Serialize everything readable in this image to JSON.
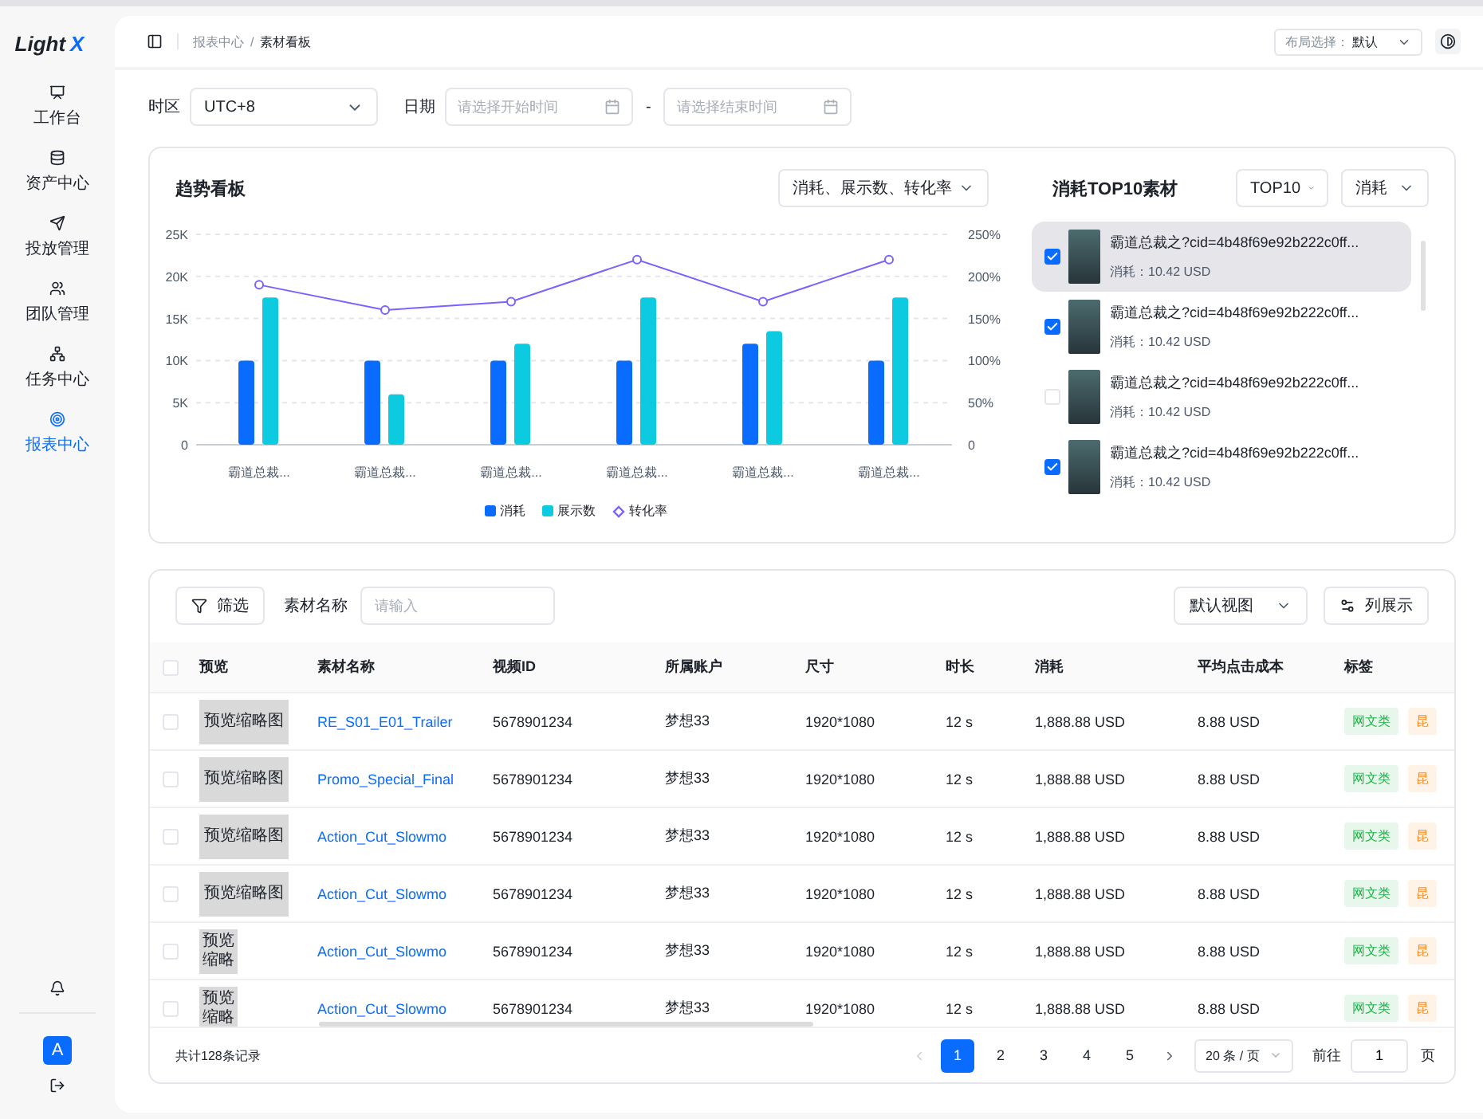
{
  "sidebar": {
    "logo": {
      "text": "Light",
      "accent": "X"
    },
    "items": [
      {
        "label": "工作台",
        "selected": false
      },
      {
        "label": "资产中心",
        "selected": false
      },
      {
        "label": "投放管理",
        "selected": false
      },
      {
        "label": "团队管理",
        "selected": false
      },
      {
        "label": "任务中心",
        "selected": false
      },
      {
        "label": "报表中心",
        "selected": true
      }
    ],
    "avatar": "A"
  },
  "header": {
    "breadcrumb": {
      "parent": "报表中心",
      "separator": "/",
      "current": "素材看板"
    },
    "layout_select": {
      "label": "布局选择：",
      "value": "默认"
    }
  },
  "filters": {
    "timezone": {
      "label": "时区",
      "value": "UTC+8"
    },
    "date": {
      "label": "日期",
      "start_placeholder": "请选择开始时间",
      "separator": "-",
      "end_placeholder": "请选择结束时间"
    }
  },
  "trend": {
    "title": "趋势看板",
    "metric_select": "消耗、展示数、转化率",
    "chart_data": {
      "type": "bar",
      "categories": [
        "霸道总裁...",
        "霸道总裁...",
        "霸道总裁...",
        "霸道总裁...",
        "霸道总裁...",
        "霸道总裁..."
      ],
      "series": [
        {
          "name": "消耗",
          "color": "#0a6cff",
          "values": [
            10000,
            10000,
            10000,
            10000,
            12000,
            10000
          ]
        },
        {
          "name": "展示数",
          "color": "#0ccbe0",
          "values": [
            17500,
            6000,
            12000,
            17500,
            13500,
            17500
          ]
        },
        {
          "name": "转化率",
          "color": "#7b61ff",
          "type": "line",
          "axis": "y2",
          "marker": "circle",
          "values": [
            190,
            160,
            170,
            220,
            170,
            220
          ]
        }
      ],
      "grid": true,
      "ylim": [
        0,
        25000
      ],
      "yticks": [
        {
          "value": 0,
          "label": "0"
        },
        {
          "value": 5000,
          "label": "5K"
        },
        {
          "value": 10000,
          "label": "10K"
        },
        {
          "value": 15000,
          "label": "15K"
        },
        {
          "value": 20000,
          "label": "20K"
        },
        {
          "value": 25000,
          "label": "25K"
        }
      ],
      "y2lim": [
        0,
        250
      ],
      "y2ticks": [
        {
          "value": 0,
          "label": "0"
        },
        {
          "value": 50,
          "label": "50%"
        },
        {
          "value": 100,
          "label": "100%"
        },
        {
          "value": 150,
          "label": "150%"
        },
        {
          "value": 200,
          "label": "200%"
        },
        {
          "value": 250,
          "label": "250%"
        }
      ]
    }
  },
  "top10": {
    "title": "消耗TOP10素材",
    "count_select": "TOP10",
    "metric_select": "消耗",
    "items": [
      {
        "title": "霸道总裁之?cid=4b48f69e92b222c0ff...",
        "spend": "消耗：10.42 USD",
        "checked": true,
        "selected": true
      },
      {
        "title": "霸道总裁之?cid=4b48f69e92b222c0ff...",
        "spend": "消耗：10.42 USD",
        "checked": true,
        "selected": false
      },
      {
        "title": "霸道总裁之?cid=4b48f69e92b222c0ff...",
        "spend": "消耗：10.42 USD",
        "checked": false,
        "selected": false
      },
      {
        "title": "霸道总裁之?cid=4b48f69e92b222c0ff...",
        "spend": "消耗：10.42 USD",
        "checked": true,
        "selected": false
      }
    ]
  },
  "table": {
    "filter_button": "筛选",
    "name_filter": {
      "label": "素材名称",
      "placeholder": "请输入"
    },
    "view_select": "默认视图",
    "columns_button": "列展示",
    "select_all_checked": false,
    "columns": [
      "预览",
      "素材名称",
      "视频ID",
      "所属账户",
      "尺寸",
      "时长",
      "消耗",
      "平均点击成本",
      "标签"
    ],
    "rows": [
      {
        "checked": false,
        "preview": {
          "kind": "wide",
          "text": "预览缩略图"
        },
        "name": "RE_S01_E01_Trailer",
        "video_id": "5678901234",
        "account": "梦想33",
        "size": "1920*1080",
        "duration": "12 s",
        "cost": "1,888.88 USD",
        "cpc": "8.88 USD",
        "tags": [
          {
            "label": "网文类",
            "color": "#22b34a"
          },
          {
            "label": "昆",
            "color": "#ff8a1f"
          }
        ]
      },
      {
        "checked": false,
        "preview": {
          "kind": "wide",
          "text": "预览缩略图"
        },
        "name": "Promo_Special_Final",
        "video_id": "5678901234",
        "account": "梦想33",
        "size": "1920*1080",
        "duration": "12 s",
        "cost": "1,888.88 USD",
        "cpc": "8.88 USD",
        "tags": [
          {
            "label": "网文类",
            "color": "#22b34a"
          },
          {
            "label": "昆",
            "color": "#ff8a1f"
          }
        ]
      },
      {
        "checked": false,
        "preview": {
          "kind": "wide",
          "text": "预览缩略图"
        },
        "name": "Action_Cut_Slowmo",
        "video_id": "5678901234",
        "account": "梦想33",
        "size": "1920*1080",
        "duration": "12 s",
        "cost": "1,888.88 USD",
        "cpc": "8.88 USD",
        "tags": [
          {
            "label": "网文类",
            "color": "#22b34a"
          },
          {
            "label": "昆",
            "color": "#ff8a1f"
          }
        ]
      },
      {
        "checked": false,
        "preview": {
          "kind": "wide",
          "text": "预览缩略图"
        },
        "name": "Action_Cut_Slowmo",
        "video_id": "5678901234",
        "account": "梦想33",
        "size": "1920*1080",
        "duration": "12 s",
        "cost": "1,888.88 USD",
        "cpc": "8.88 USD",
        "tags": [
          {
            "label": "网文类",
            "color": "#22b34a"
          },
          {
            "label": "昆",
            "color": "#ff8a1f"
          }
        ]
      },
      {
        "checked": false,
        "preview": {
          "kind": "narrow",
          "text": "预览缩略"
        },
        "name": "Action_Cut_Slowmo",
        "video_id": "5678901234",
        "account": "梦想33",
        "size": "1920*1080",
        "duration": "12 s",
        "cost": "1,888.88 USD",
        "cpc": "8.88 USD",
        "tags": [
          {
            "label": "网文类",
            "color": "#22b34a"
          },
          {
            "label": "昆",
            "color": "#ff8a1f"
          }
        ]
      },
      {
        "checked": false,
        "preview": {
          "kind": "narrow",
          "text": "预览缩略"
        },
        "name": "Action_Cut_Slowmo",
        "video_id": "5678901234",
        "account": "梦想33",
        "size": "1920*1080",
        "duration": "12 s",
        "cost": "1,888.88 USD",
        "cpc": "8.88 USD",
        "tags": [
          {
            "label": "网文类",
            "color": "#22b34a"
          },
          {
            "label": "昆",
            "color": "#ff8a1f"
          }
        ]
      }
    ],
    "total": "共计128条记录",
    "pagination": {
      "prev_disabled": true,
      "pages": [
        {
          "label": "1",
          "selected": true
        },
        {
          "label": "2",
          "selected": false
        },
        {
          "label": "3",
          "selected": false
        },
        {
          "label": "4",
          "selected": false
        },
        {
          "label": "5",
          "selected": false
        }
      ],
      "page_size": "20 条 / 页",
      "goto_label": "前往",
      "goto_value": "1",
      "goto_suffix": "页"
    }
  }
}
